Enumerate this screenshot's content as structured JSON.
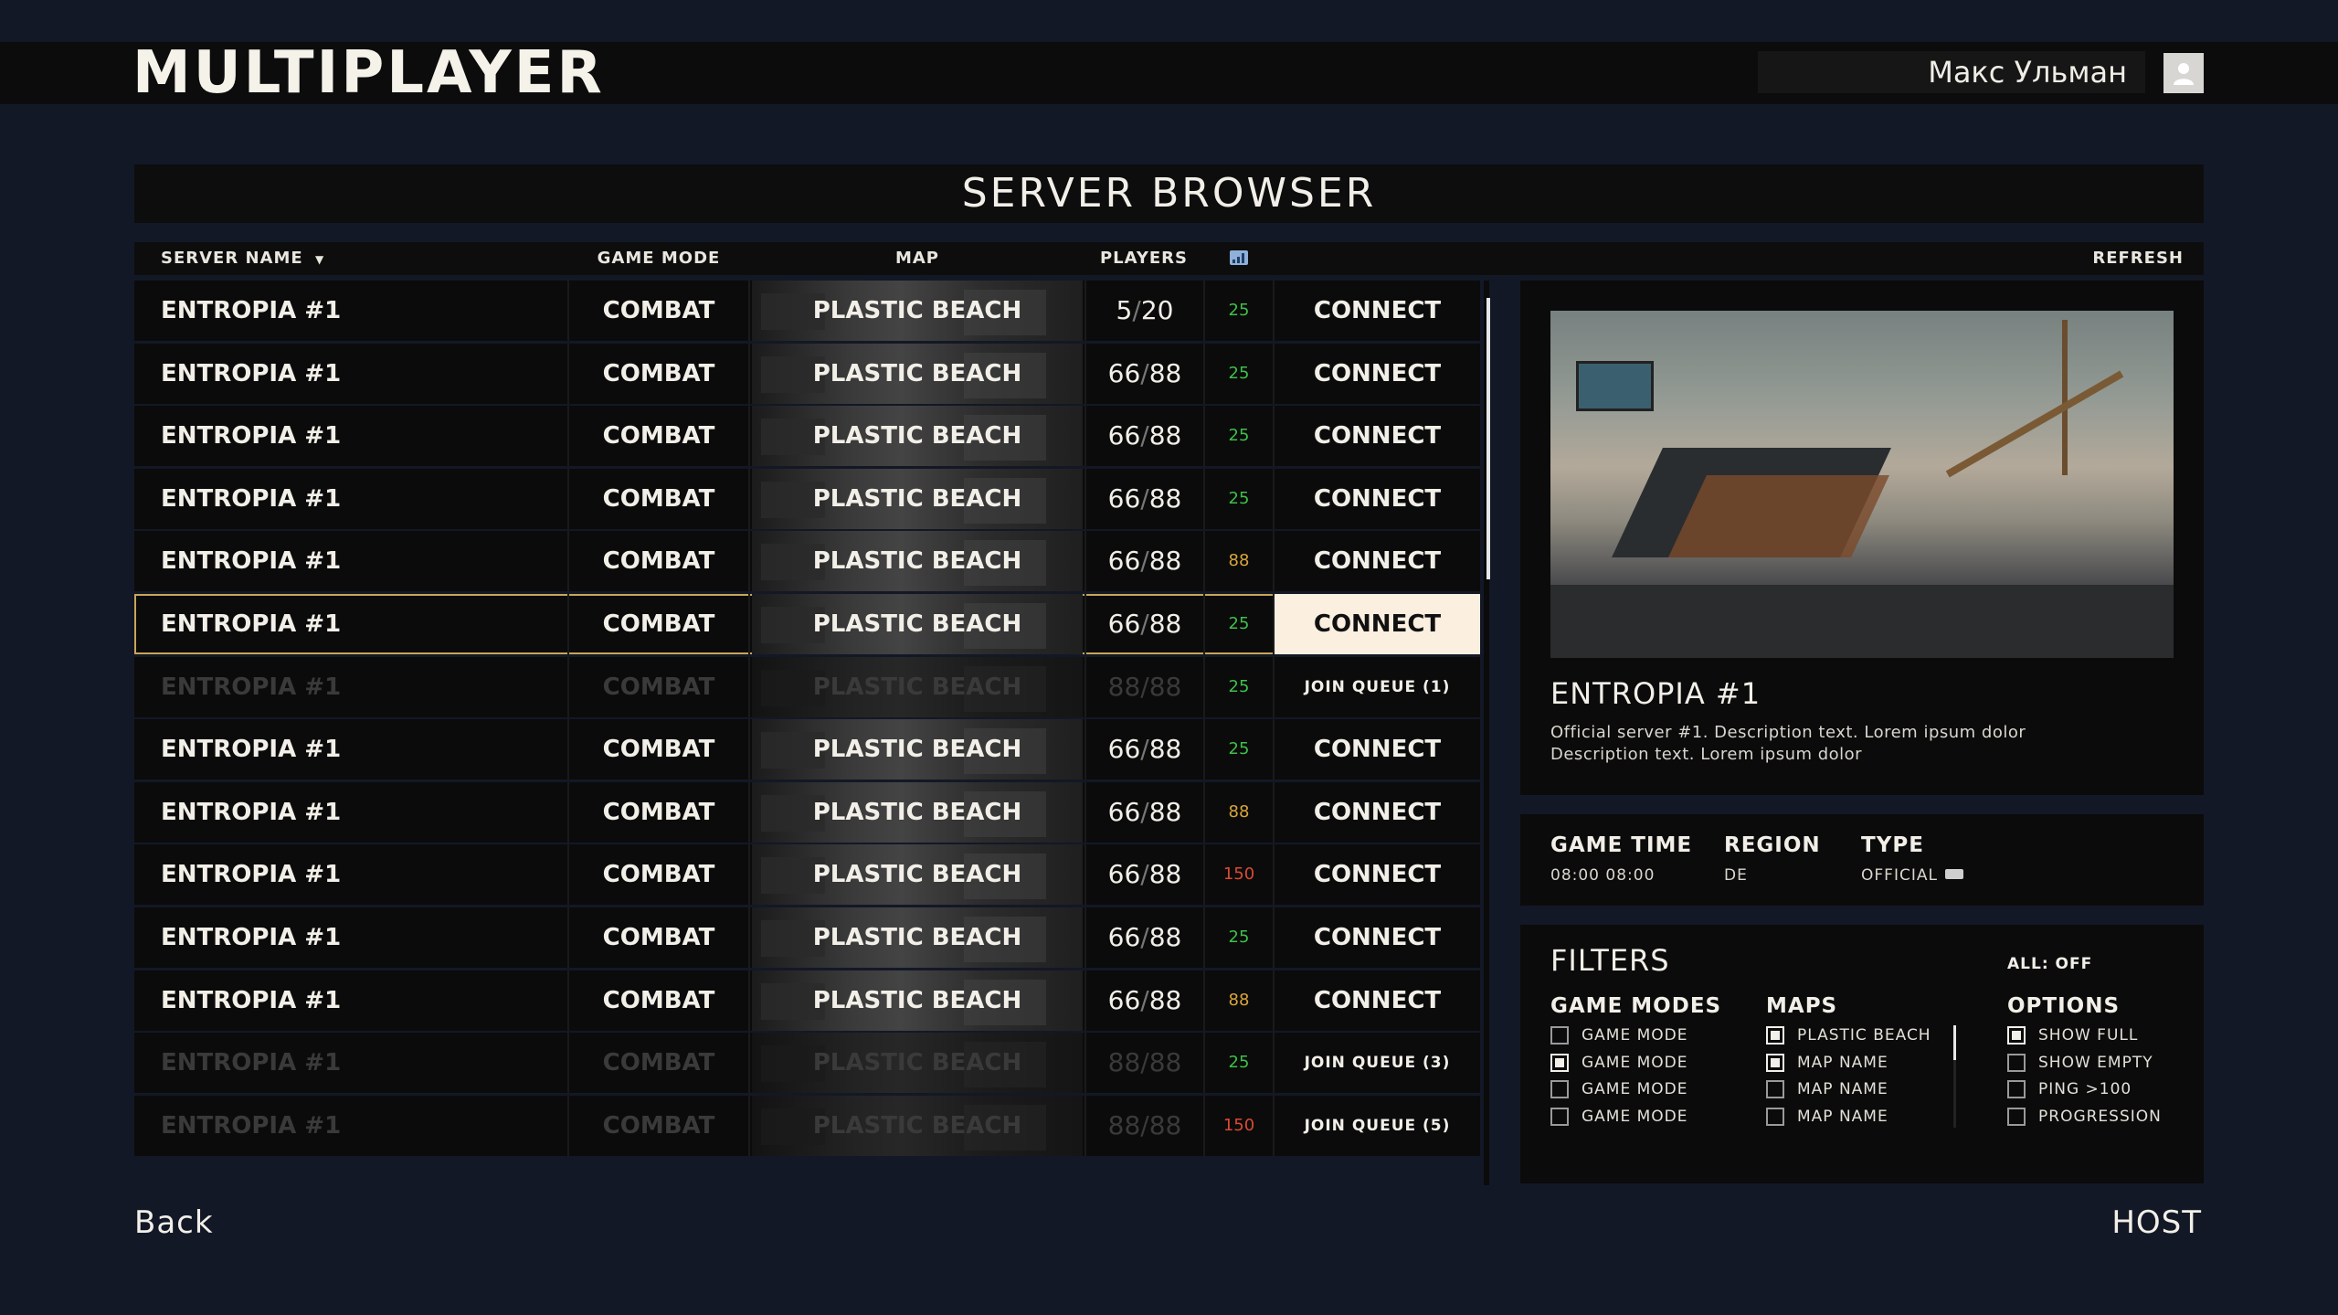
{
  "header": {
    "title": "MULTIPLAYER",
    "user_name": "Макс Ульман",
    "avatar_icon": "user-icon"
  },
  "browser": {
    "title": "SERVER BROWSER",
    "columns": {
      "server_name": "SERVER NAME",
      "sort_indicator": "▼",
      "game_mode": "GAME MODE",
      "map": "MAP",
      "players": "PLAYERS",
      "ping_icon": "signal-icon",
      "refresh": "REFRESH"
    },
    "rows": [
      {
        "name": "ENTROPIA #1",
        "mode": "COMBAT",
        "map": "PLASTIC BEACH",
        "players_cur": "5",
        "players_max": "20",
        "ping": "25",
        "ping_level": "green",
        "action": "CONNECT",
        "state": "normal"
      },
      {
        "name": "ENTROPIA #1",
        "mode": "COMBAT",
        "map": "PLASTIC BEACH",
        "players_cur": "66",
        "players_max": "88",
        "ping": "25",
        "ping_level": "green",
        "action": "CONNECT",
        "state": "normal"
      },
      {
        "name": "ENTROPIA #1",
        "mode": "COMBAT",
        "map": "PLASTIC BEACH",
        "players_cur": "66",
        "players_max": "88",
        "ping": "25",
        "ping_level": "green",
        "action": "CONNECT",
        "state": "normal"
      },
      {
        "name": "ENTROPIA #1",
        "mode": "COMBAT",
        "map": "PLASTIC BEACH",
        "players_cur": "66",
        "players_max": "88",
        "ping": "25",
        "ping_level": "green",
        "action": "CONNECT",
        "state": "normal"
      },
      {
        "name": "ENTROPIA #1",
        "mode": "COMBAT",
        "map": "PLASTIC BEACH",
        "players_cur": "66",
        "players_max": "88",
        "ping": "88",
        "ping_level": "yellow",
        "action": "CONNECT",
        "state": "normal"
      },
      {
        "name": "ENTROPIA #1",
        "mode": "COMBAT",
        "map": "PLASTIC BEACH",
        "players_cur": "66",
        "players_max": "88",
        "ping": "25",
        "ping_level": "green",
        "action": "CONNECT",
        "state": "selected"
      },
      {
        "name": "ENTROPIA #1",
        "mode": "COMBAT",
        "map": "PLASTIC BEACH",
        "players_cur": "88",
        "players_max": "88",
        "ping": "25",
        "ping_level": "green",
        "action": "JOIN QUEUE (1)",
        "state": "full"
      },
      {
        "name": "ENTROPIA #1",
        "mode": "COMBAT",
        "map": "PLASTIC BEACH",
        "players_cur": "66",
        "players_max": "88",
        "ping": "25",
        "ping_level": "green",
        "action": "CONNECT",
        "state": "normal"
      },
      {
        "name": "ENTROPIA #1",
        "mode": "COMBAT",
        "map": "PLASTIC BEACH",
        "players_cur": "66",
        "players_max": "88",
        "ping": "88",
        "ping_level": "yellow",
        "action": "CONNECT",
        "state": "normal"
      },
      {
        "name": "ENTROPIA #1",
        "mode": "COMBAT",
        "map": "PLASTIC BEACH",
        "players_cur": "66",
        "players_max": "88",
        "ping": "150",
        "ping_level": "red",
        "action": "CONNECT",
        "state": "normal"
      },
      {
        "name": "ENTROPIA #1",
        "mode": "COMBAT",
        "map": "PLASTIC BEACH",
        "players_cur": "66",
        "players_max": "88",
        "ping": "25",
        "ping_level": "green",
        "action": "CONNECT",
        "state": "normal"
      },
      {
        "name": "ENTROPIA #1",
        "mode": "COMBAT",
        "map": "PLASTIC BEACH",
        "players_cur": "66",
        "players_max": "88",
        "ping": "88",
        "ping_level": "yellow",
        "action": "CONNECT",
        "state": "normal"
      },
      {
        "name": "ENTROPIA #1",
        "mode": "COMBAT",
        "map": "PLASTIC BEACH",
        "players_cur": "88",
        "players_max": "88",
        "ping": "25",
        "ping_level": "green",
        "action": "JOIN QUEUE (3)",
        "state": "full"
      },
      {
        "name": "ENTROPIA #1",
        "mode": "COMBAT",
        "map": "PLASTIC BEACH",
        "players_cur": "88",
        "players_max": "88",
        "ping": "150",
        "ping_level": "red",
        "action": "JOIN QUEUE (5)",
        "state": "full"
      }
    ]
  },
  "details": {
    "server_name": "ENTROPIA #1",
    "description_line1": "Official server #1. Description text. Lorem ipsum dolor",
    "description_line2": "Description text. Lorem ipsum dolor",
    "game_time_label": "GAME TIME",
    "game_time_value": "08:00 08:00",
    "region_label": "REGION",
    "region_value": "DE",
    "type_label": "TYPE",
    "type_value": "OFFICIAL",
    "type_icon": "tag-icon"
  },
  "filters": {
    "title": "FILTERS",
    "all_toggle": "ALL: OFF",
    "game_modes": {
      "title": "GAME MODES",
      "items": [
        {
          "label": "GAME MODE",
          "checked": false
        },
        {
          "label": "GAME MODE",
          "checked": true
        },
        {
          "label": "GAME MODE",
          "checked": false
        },
        {
          "label": "GAME MODE",
          "checked": false
        }
      ]
    },
    "maps": {
      "title": "MAPS",
      "items": [
        {
          "label": "PLASTIC BEACH",
          "checked": true
        },
        {
          "label": "MAP NAME",
          "checked": true
        },
        {
          "label": "MAP NAME",
          "checked": false
        },
        {
          "label": "MAP NAME",
          "checked": false
        }
      ]
    },
    "options": {
      "title": "OPTIONS",
      "items": [
        {
          "label": "SHOW FULL",
          "checked": true
        },
        {
          "label": "SHOW EMPTY",
          "checked": false
        },
        {
          "label": "PING >100",
          "checked": false
        },
        {
          "label": "PROGRESSION",
          "checked": false
        }
      ]
    }
  },
  "footer": {
    "back_label": "Back",
    "host_label": "HOST"
  },
  "colors": {
    "background": "#121826",
    "accent_selected_border": "#c8a558",
    "selected_button_bg": "#fbefe0",
    "ping_green": "#3fbf4a",
    "ping_yellow": "#d8a53a",
    "ping_red": "#d94a32"
  }
}
